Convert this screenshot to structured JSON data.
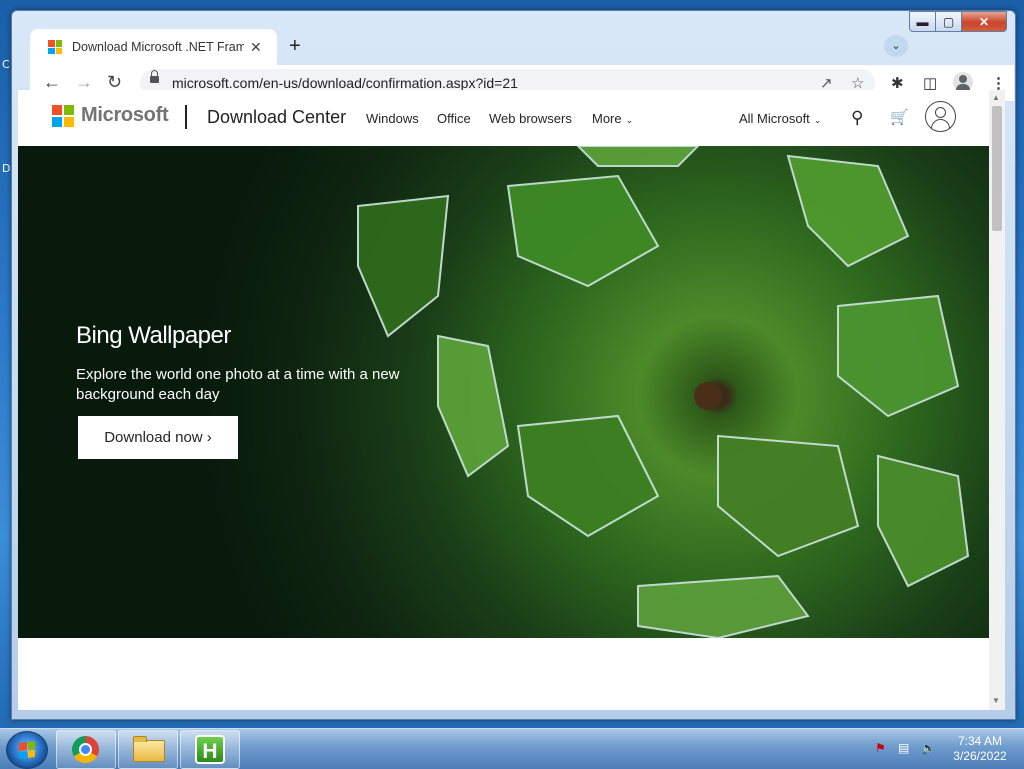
{
  "browser": {
    "tab_title": "Download Microsoft .NET Frame",
    "new_tab_symbol": "+",
    "url": "microsoft.com/en-us/download/confirmation.aspx?id=21"
  },
  "header": {
    "brand": "Microsoft",
    "site_title": "Download Center",
    "nav": [
      "Windows",
      "Office",
      "Web browsers",
      "More"
    ],
    "all_microsoft": "All Microsoft"
  },
  "hero": {
    "title": "Bing Wallpaper",
    "subtitle": "Explore the world one photo at a time with a new background each day",
    "button_label": "Download now ›"
  },
  "taskbar": {
    "time": "7:34 AM",
    "date": "3/26/2022",
    "app_h_label": "H"
  },
  "colors": {
    "ms_red": "#f25022",
    "ms_green": "#7fba00",
    "ms_blue": "#00a4ef",
    "ms_yellow": "#ffb900"
  },
  "icons": [
    "back-arrow-icon",
    "forward-arrow-icon",
    "reload-icon",
    "lock-icon",
    "share-icon",
    "star-icon",
    "extensions-icon",
    "sidebar-icon",
    "profile-icon",
    "menu-icon",
    "search-icon",
    "cart-icon",
    "avatar-icon"
  ]
}
